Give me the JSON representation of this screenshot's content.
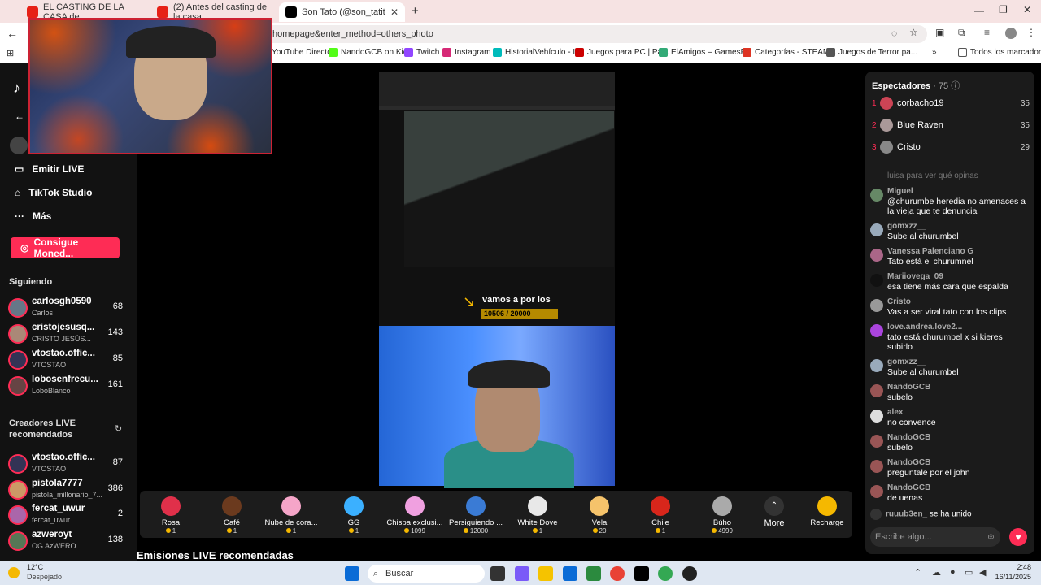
{
  "browser": {
    "tabs": [
      {
        "title": "EL CASTING DE LA CASA de",
        "color": "#e62117"
      },
      {
        "title": "(2) Antes del casting de la casa",
        "color": "#e62117"
      },
      {
        "title": "Son Tato (@son_tatito) está",
        "color": "#000000"
      }
    ],
    "new_tab": "+",
    "url": "homepage&enter_method=others_photo",
    "bookmarks": [
      {
        "label": "YouTube Directo",
        "color": "#e62117"
      },
      {
        "label": "NandoGCB on Kick",
        "color": "#53fc18"
      },
      {
        "label": "Twitch",
        "color": "#9146ff"
      },
      {
        "label": "Instagram",
        "color": "#d62976"
      },
      {
        "label": "HistorialVehículo - I...",
        "color": "#0bb"
      },
      {
        "label": "Juegos para PC | Pá...",
        "color": "#c00"
      },
      {
        "label": "ElAmigos – GamesF...",
        "color": "#3a7"
      },
      {
        "label": "Categorías - STEAM...",
        "color": "#d32"
      },
      {
        "label": "Juegos de Terror pa...",
        "color": "#555"
      }
    ],
    "all_bookmarks": "Todos los marcadores"
  },
  "sidebar": {
    "nav": [
      {
        "label": "Emitir LIVE",
        "icon": "video-icon"
      },
      {
        "label": "TikTok Studio",
        "icon": "home-icon"
      },
      {
        "label": "Más",
        "icon": "more-icon"
      }
    ],
    "coins_button": "Consigue Moned...",
    "following_header": "Siguiendo",
    "following": [
      {
        "name": "carlosgh0590",
        "sub": "Carlos",
        "count": "68"
      },
      {
        "name": "cristojesusq...",
        "sub": "CRISTO JESÚS...",
        "count": "143"
      },
      {
        "name": "vtostao.offic...",
        "sub": "VTOSTAO",
        "count": "85"
      },
      {
        "name": "lobosenfrecu...",
        "sub": "LoboBlanco",
        "count": "161"
      }
    ],
    "recommended_header": "Creadores LIVE recomendados",
    "recommended": [
      {
        "name": "vtostao.offic...",
        "sub": "VTOSTAO",
        "count": "87"
      },
      {
        "name": "pistola7777",
        "sub": "pistola_millonario_7...",
        "count": "386"
      },
      {
        "name": "fercat_uwur",
        "sub": "fercat_uwur",
        "count": "2"
      },
      {
        "name": "azweroyt",
        "sub": "OG AzWERO",
        "count": "138"
      }
    ]
  },
  "stream": {
    "goal_text": "vamos a por los",
    "goal_progress": "10506 / 20000"
  },
  "gifts": [
    {
      "name": "Rosa",
      "price": "1",
      "color": "#e0304a"
    },
    {
      "name": "Café",
      "price": "1",
      "color": "#6b3a1e"
    },
    {
      "name": "Nube de cora...",
      "price": "1",
      "color": "#f5a5c8"
    },
    {
      "name": "GG",
      "price": "1",
      "color": "#3bb0ff"
    },
    {
      "name": "Chispa exclusi...",
      "price": "1099",
      "color": "#f0a0e0"
    },
    {
      "name": "Persiguiendo ...",
      "price": "12000",
      "color": "#3a7bd5"
    },
    {
      "name": "White Dove",
      "price": "1",
      "color": "#e8e8e8"
    },
    {
      "name": "Vela",
      "price": "20",
      "color": "#f5c36b"
    },
    {
      "name": "Chile",
      "price": "1",
      "color": "#d8261b"
    },
    {
      "name": "Búho",
      "price": "4999",
      "color": "#aaaaaa"
    }
  ],
  "gift_more": "More",
  "gift_recharge": "Recharge",
  "recommended_title": "Emisiones LIVE recomendadas",
  "chat": {
    "header": "Espectadores",
    "viewer_count": "· 75",
    "top": [
      {
        "rank": "1",
        "name": "corbacho19",
        "score": "35"
      },
      {
        "rank": "2",
        "name": "Blue Raven",
        "score": "35"
      },
      {
        "rank": "3",
        "name": "Cristo",
        "score": "29"
      }
    ],
    "faded": "luisa para ver qué opinas",
    "messages": [
      {
        "user": "Miguel",
        "text": "@churumbe heredia no amenaces a la vieja que te denuncia"
      },
      {
        "user": "gomxzz__",
        "text": "Sube al churumbel"
      },
      {
        "user": "Vanessa Palenciano G",
        "text": "Tato está el churumnel"
      },
      {
        "user": "Mariiovega_09",
        "text": "esa tiene más cara que espalda"
      },
      {
        "user": "Cristo",
        "text": "Vas a ser viral tato con los clips"
      },
      {
        "user": "love.andrea.love2...",
        "text": "tato está churumbel x si kieres subirlo"
      },
      {
        "user": "gomxzz__",
        "text": "Sube al churumbel"
      },
      {
        "user": "NandoGCB",
        "text": "subelo"
      },
      {
        "user": "alex",
        "text": "no convence"
      },
      {
        "user": "NandoGCB",
        "text": "subelo"
      },
      {
        "user": "NandoGCB",
        "text": "preguntale por el john"
      },
      {
        "user": "NandoGCB",
        "text": "de uenas"
      }
    ],
    "join_user": "ruuub3en_",
    "join_text": "se ha unido",
    "input_placeholder": "Escribe algo..."
  },
  "taskbar": {
    "weather_temp": "12°C",
    "weather_desc": "Despejado",
    "search": "Buscar",
    "time": "2:48",
    "date": "16/11/2025"
  }
}
